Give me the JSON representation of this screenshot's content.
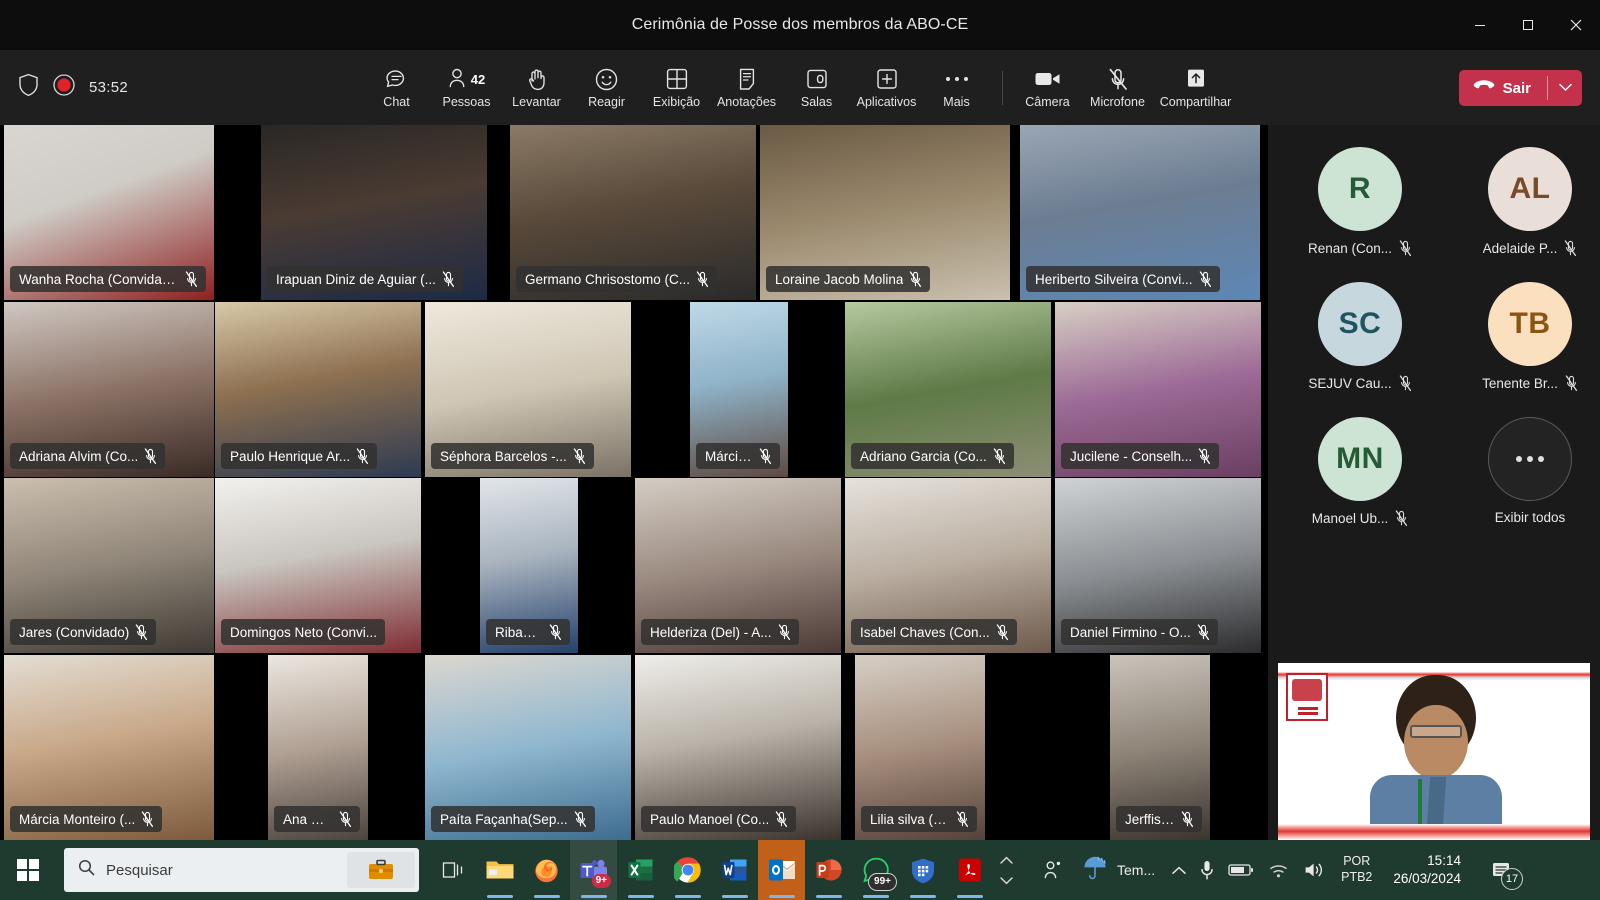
{
  "window": {
    "title": "Cerimônia de Posse dos membros da ABO-CE",
    "controls": {
      "minimize": "minimize-icon",
      "maximize": "maximize-icon",
      "close": "close-icon"
    }
  },
  "toolbar": {
    "shield_icon": "shield-icon",
    "recording_icon": "recording-icon",
    "recording_time": "53:52",
    "items": [
      {
        "label": "Chat",
        "icon": "chat-icon",
        "badge": ""
      },
      {
        "label": "Pessoas",
        "icon": "people-icon",
        "badge": "42"
      },
      {
        "label": "Levantar",
        "icon": "raise-hand-icon",
        "badge": ""
      },
      {
        "label": "Reagir",
        "icon": "reactions-smiley-icon",
        "badge": ""
      },
      {
        "label": "Exibição",
        "icon": "view-grid-icon",
        "badge": ""
      },
      {
        "label": "Anotações",
        "icon": "notes-icon",
        "badge": ""
      },
      {
        "label": "Salas",
        "icon": "breakout-rooms-icon",
        "badge": ""
      },
      {
        "label": "Aplicativos",
        "icon": "apps-plus-icon",
        "badge": ""
      },
      {
        "label": "Mais",
        "icon": "more-ellipsis-icon",
        "badge": ""
      }
    ],
    "devices": [
      {
        "label": "Câmera",
        "icon": "camera-icon",
        "state": "on"
      },
      {
        "label": "Microfone",
        "icon": "microphone-muted-icon",
        "state": "muted"
      },
      {
        "label": "Compartilhar",
        "icon": "share-screen-icon",
        "state": "off"
      }
    ],
    "leave": {
      "label": "Sair",
      "icon": "hangup-icon",
      "caret": "chevron-down-icon",
      "color": "#c4314b"
    }
  },
  "stage": {
    "tiles": [
      {
        "name": "Wanha Rocha (Convidado)",
        "muted": true,
        "active": false,
        "row": 0,
        "col": 0
      },
      {
        "name": "Irapuan Diniz de Aguiar (...",
        "muted": true,
        "active": false,
        "row": 0,
        "col": 1
      },
      {
        "name": "Germano Chrisostomo (C...",
        "muted": true,
        "active": false,
        "row": 0,
        "col": 2
      },
      {
        "name": "Loraine Jacob Molina",
        "muted": true,
        "active": false,
        "row": 0,
        "col": 3
      },
      {
        "name": "Heriberto Silveira (Convi...",
        "muted": true,
        "active": false,
        "row": 0,
        "col": 4
      },
      {
        "name": "Adriana Alvim (Co...",
        "muted": true,
        "active": false,
        "row": 1,
        "col": 0
      },
      {
        "name": "Paulo Henrique Ar...",
        "muted": true,
        "active": false,
        "row": 1,
        "col": 1
      },
      {
        "name": "Séphora Barcelos -...",
        "muted": true,
        "active": false,
        "row": 1,
        "col": 2
      },
      {
        "name": "Márcia Ximenes (C...",
        "muted": true,
        "active": false,
        "row": 1,
        "col": 3
      },
      {
        "name": "Adriano Garcia (Co...",
        "muted": true,
        "active": false,
        "row": 1,
        "col": 4
      },
      {
        "name": "Jucilene - Conselh...",
        "muted": true,
        "active": false,
        "row": 1,
        "col": 5
      },
      {
        "name": "Jares (Convidado)",
        "muted": true,
        "active": false,
        "row": 2,
        "col": 0
      },
      {
        "name": "Domingos Neto (Convi...",
        "muted": false,
        "active": true,
        "row": 2,
        "col": 1
      },
      {
        "name": "Ribamar (Convida...",
        "muted": true,
        "active": false,
        "row": 2,
        "col": 2
      },
      {
        "name": "Helderiza (Del) - A...",
        "muted": true,
        "active": false,
        "row": 2,
        "col": 3
      },
      {
        "name": "Isabel Chaves (Con...",
        "muted": true,
        "active": false,
        "row": 2,
        "col": 4
      },
      {
        "name": "Daniel Firmino - O...",
        "muted": true,
        "active": false,
        "row": 2,
        "col": 5
      },
      {
        "name": "Márcia Monteiro (...",
        "muted": true,
        "active": false,
        "row": 3,
        "col": 0
      },
      {
        "name": "Ana Célia cristino ...",
        "muted": true,
        "active": false,
        "row": 3,
        "col": 1
      },
      {
        "name": "Paíta Façanha(Sep...",
        "muted": true,
        "active": false,
        "row": 3,
        "col": 2
      },
      {
        "name": "Paulo Manoel (Co...",
        "muted": true,
        "active": false,
        "row": 3,
        "col": 3
      },
      {
        "name": "Lilia silva (Convida...",
        "muted": true,
        "active": false,
        "row": 3,
        "col": 4
      },
      {
        "name": "Jerffison Pereira d...",
        "muted": true,
        "active": false,
        "row": 3,
        "col": 5
      }
    ]
  },
  "rail": {
    "avatars": [
      {
        "initials": "R",
        "name": "Renan (Con...",
        "muted": true,
        "bg": "#cde3d4",
        "fg": "#235c35"
      },
      {
        "initials": "AL",
        "name": "Adelaide P...",
        "muted": true,
        "bg": "#eadfd8",
        "fg": "#7a4a2a"
      },
      {
        "initials": "SC",
        "name": "SEJUV Cau...",
        "muted": true,
        "bg": "#c6d8de",
        "fg": "#1f5560"
      },
      {
        "initials": "TB",
        "name": "Tenente Br...",
        "muted": true,
        "bg": "#fbe0c0",
        "fg": "#8a5510"
      },
      {
        "initials": "MN",
        "name": "Manoel Ub...",
        "muted": true,
        "bg": "#cde3d4",
        "fg": "#235c35"
      }
    ],
    "show_all": {
      "label": "Exibir todos",
      "icon": "more-ellipsis-icon"
    }
  },
  "taskbar": {
    "start": "windows-start-icon",
    "search": {
      "placeholder": "Pesquisar",
      "icon": "search-icon",
      "briefcase_icon": "briefcase-icon"
    },
    "task_view": "task-view-icon",
    "apps": [
      {
        "name": "file-explorer-icon",
        "badge": "",
        "state": "open"
      },
      {
        "name": "firefox-icon",
        "badge": "",
        "state": "open"
      },
      {
        "name": "microsoft-teams-icon",
        "badge": "9+",
        "state": "focused"
      },
      {
        "name": "microsoft-excel-icon",
        "badge": "",
        "state": "open"
      },
      {
        "name": "google-chrome-icon",
        "badge": "",
        "state": "open"
      },
      {
        "name": "microsoft-word-icon",
        "badge": "",
        "state": "open"
      },
      {
        "name": "microsoft-outlook-icon",
        "badge": "",
        "state": "active"
      },
      {
        "name": "microsoft-powerpoint-icon",
        "badge": "",
        "state": "open"
      },
      {
        "name": "whatsapp-icon",
        "badge": "99+",
        "state": "open"
      },
      {
        "name": "security-shield-icon",
        "badge": "",
        "state": "open"
      },
      {
        "name": "adobe-acrobat-icon",
        "badge": "",
        "state": "open"
      }
    ],
    "tray": {
      "people_icon": "people-nearby-icon",
      "weather_icon": "weather-rain-icon",
      "weather_label": "Tem...",
      "chevron_icon": "chevron-up-icon",
      "mic_icon": "microphone-icon",
      "battery_icon": "battery-icon",
      "network_icon": "wifi-icon",
      "volume_icon": "volume-icon",
      "lang_top": "POR",
      "lang_bottom": "PTB2",
      "time": "15:14",
      "date": "26/03/2024",
      "notification_icon": "notifications-icon",
      "notification_count": "17"
    }
  }
}
